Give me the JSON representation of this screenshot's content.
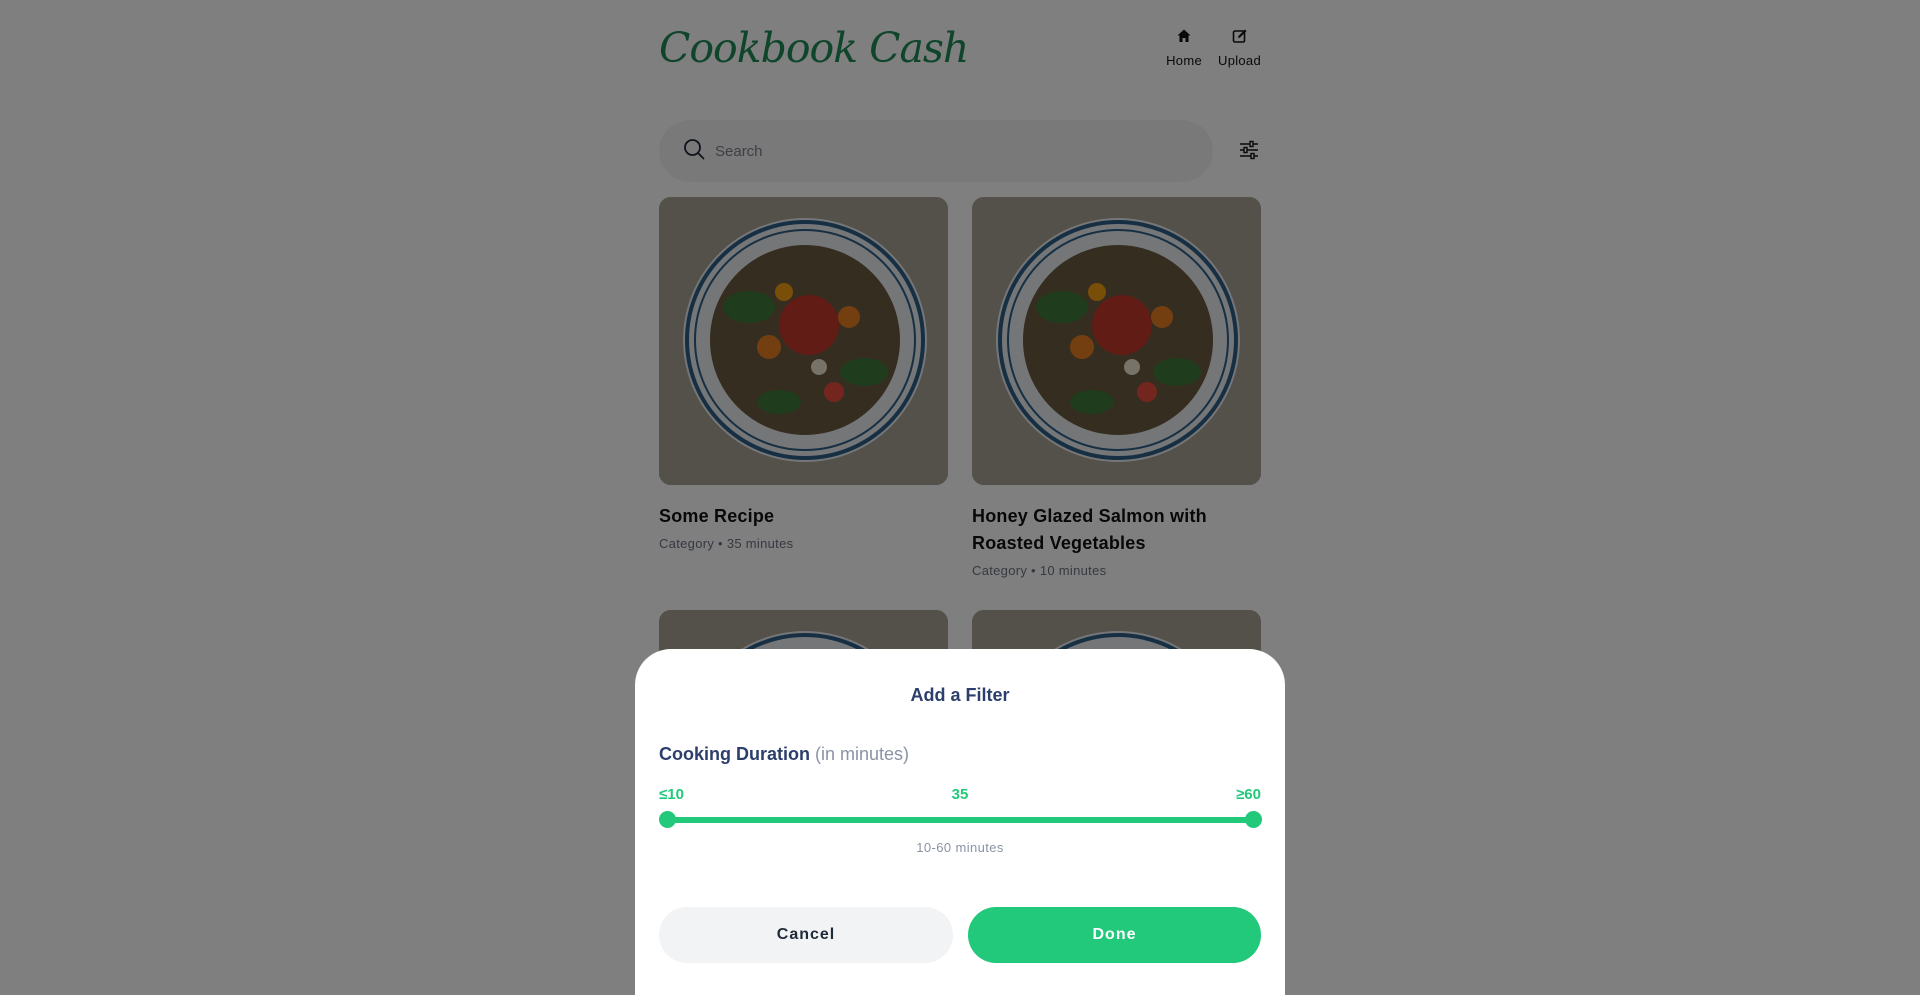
{
  "app": {
    "title": "Cookbook Cash"
  },
  "nav": {
    "items": [
      {
        "label": "Home",
        "icon": "home-icon"
      },
      {
        "label": "Upload",
        "icon": "edit-icon"
      }
    ]
  },
  "search": {
    "placeholder": "Search",
    "value": ""
  },
  "recipes": [
    {
      "title": "Some Recipe",
      "meta": "Category • 35 minutes"
    },
    {
      "title": "Honey Glazed Salmon with Roasted Vegetables",
      "meta": "Category • 10 minutes"
    },
    {
      "title": "",
      "meta": ""
    },
    {
      "title": "",
      "meta": ""
    }
  ],
  "modal": {
    "title": "Add a Filter",
    "section_label": "Cooking Duration",
    "section_sub": "(in minutes)",
    "min_label": "≤10",
    "mid_label": "35",
    "max_label": "≥60",
    "range_caption": "10-60 minutes",
    "range": {
      "min": 10,
      "max": 60,
      "selected_low": 10,
      "selected_high": 60
    },
    "cancel_label": "Cancel",
    "done_label": "Done"
  },
  "colors": {
    "brand": "#1f8a57",
    "accent": "#22c97a",
    "heading": "#2c3e6b",
    "muted": "#8a93a6"
  }
}
